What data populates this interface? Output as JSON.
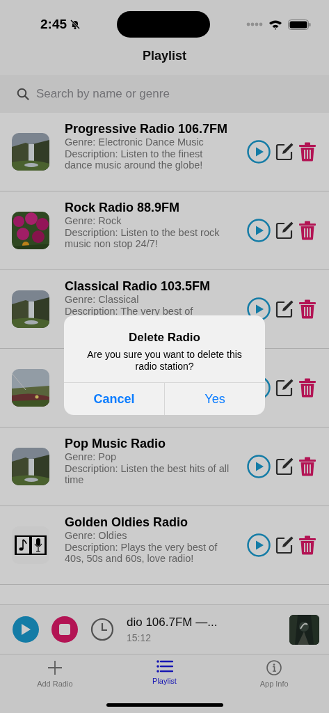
{
  "status_bar": {
    "time": "2:45"
  },
  "nav": {
    "title": "Playlist"
  },
  "search": {
    "placeholder": "Search by name or genre"
  },
  "stations": [
    {
      "kind": "station",
      "title": "Progressive Radio 106.7FM",
      "genre": "Genre: Electronic Dance Music",
      "description": "Description: Listen to the finest dance music around the globe!"
    },
    {
      "kind": "station",
      "title": "Rock Radio 88.9FM",
      "genre": "Genre: Rock",
      "description": "Description: Listen to the best rock music non stop 24/7!"
    },
    {
      "kind": "station",
      "title": "Classical Radio 103.5FM",
      "genre": "Genre: Classical",
      "description": "Description: The very best of"
    },
    {
      "kind": "station"
    },
    {
      "kind": "station",
      "title": "Pop Music Radio",
      "genre": "Genre: Pop",
      "description": "Description: Listen the best hits of all time"
    },
    {
      "kind": "logo",
      "title": "Golden Oldies Radio",
      "genre": "Genre: Oldies",
      "description": "Description: Plays the very best of 40s, 50s and 60s, love radio!"
    }
  ],
  "mini_player": {
    "now_playing": "dio 106.7FM —...",
    "time": "15:12"
  },
  "tabs": [
    {
      "label": "Add Radio",
      "selected": false
    },
    {
      "label": "Playlist",
      "selected": true
    },
    {
      "label": "App Info",
      "selected": false
    }
  ],
  "alert": {
    "title": "Delete Radio",
    "message": "Are you sure you want to delete this radio station?",
    "buttons": [
      {
        "label": "Cancel",
        "kind": "cancel"
      },
      {
        "label": "Yes",
        "kind": "default"
      }
    ]
  }
}
